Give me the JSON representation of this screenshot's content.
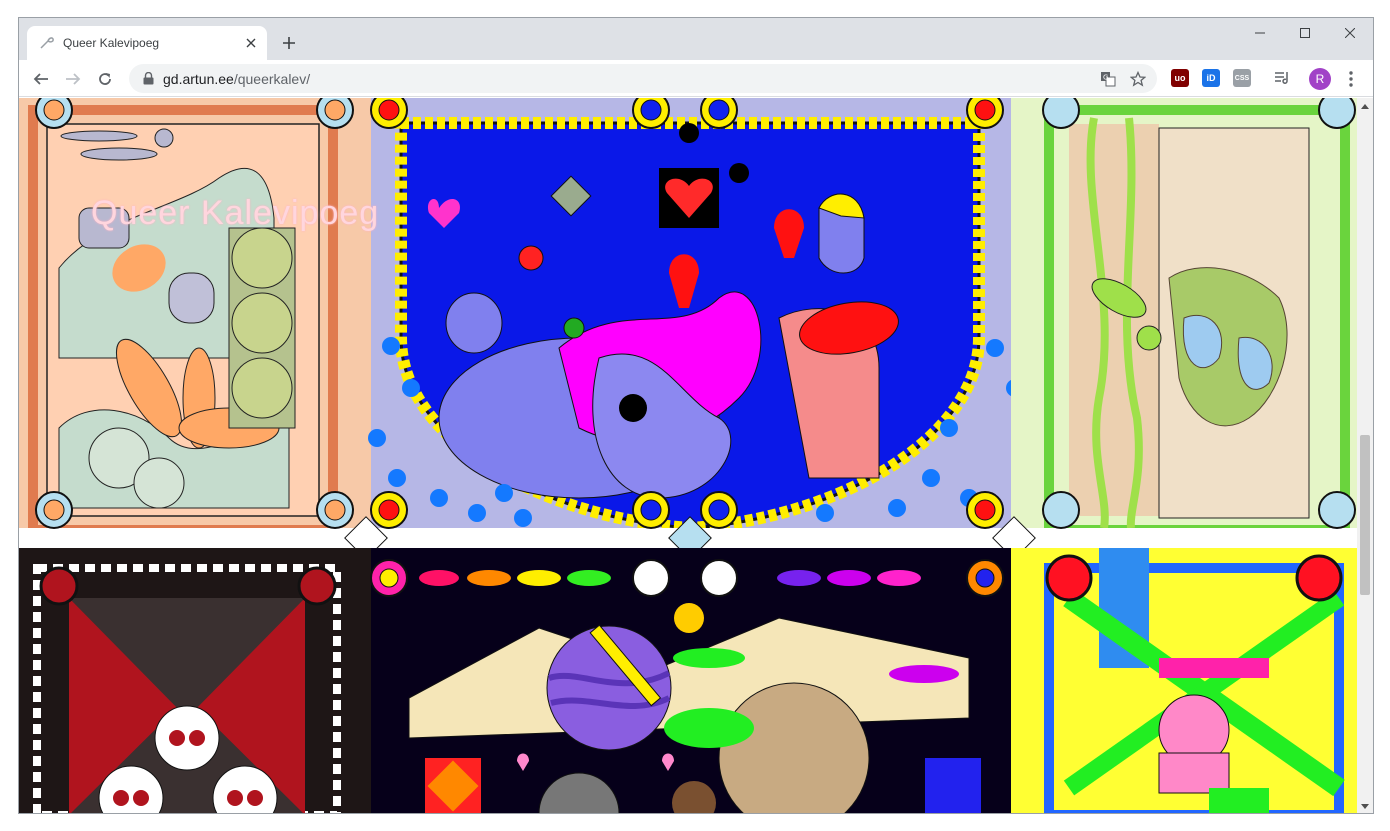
{
  "browser": {
    "tab_title": "Queer Kalevipoeg",
    "url_host": "gd.artun.ee",
    "url_path": "/queerkalev/",
    "profile_initial": "R",
    "extensions": [
      {
        "name": "ublock-icon",
        "label": "uo",
        "color": "#800000"
      },
      {
        "name": "id-extension-icon",
        "label": "iD",
        "color": "#1a73e8"
      },
      {
        "name": "css-extension-icon",
        "label": "CSS",
        "color": "#9aa0a6"
      }
    ]
  },
  "page": {
    "title": "Queer Kalevipoeg"
  },
  "colors": {
    "accent_avatar": "#a142c7",
    "tabstrip": "#dee1e6"
  }
}
